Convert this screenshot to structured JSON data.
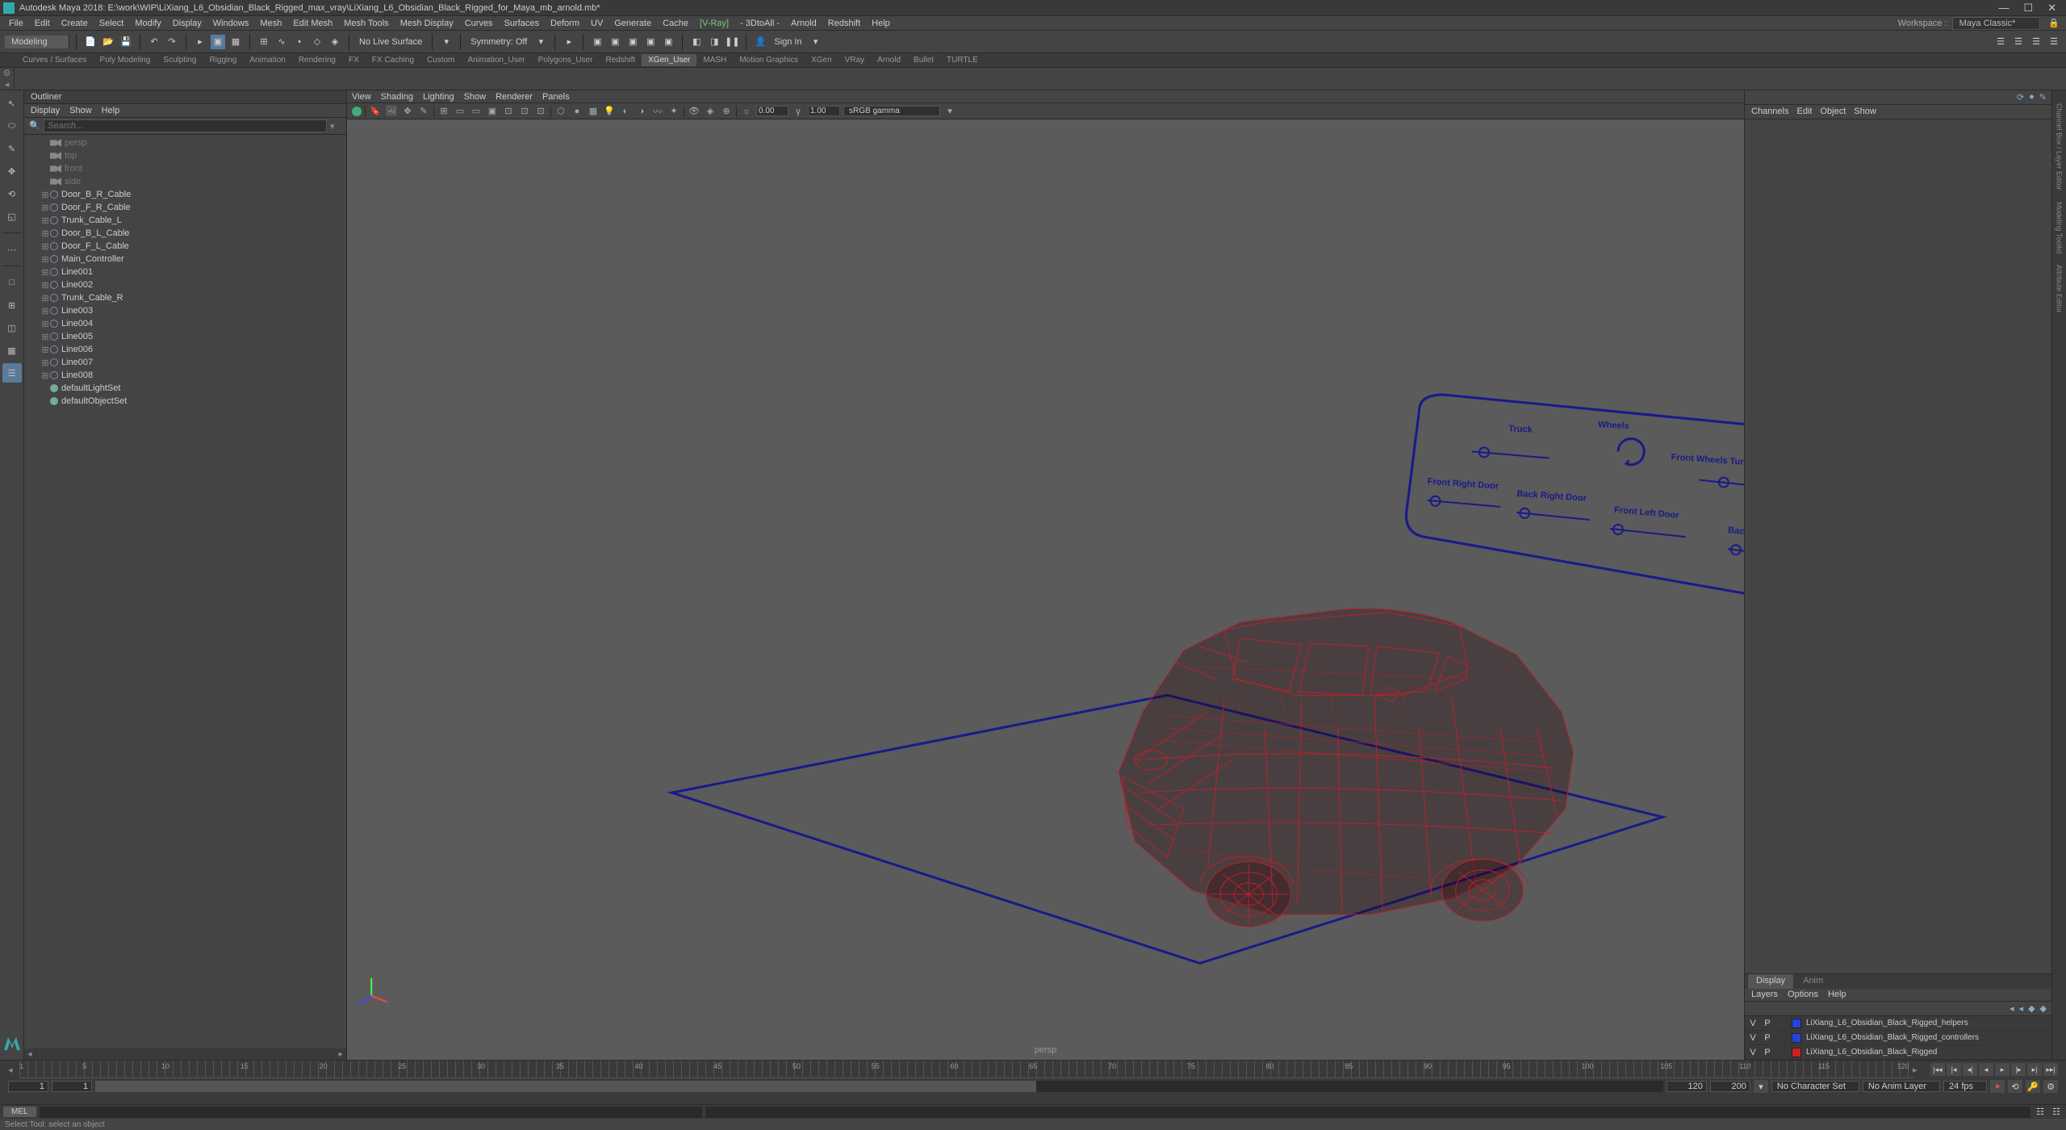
{
  "app": {
    "title": "Autodesk Maya 2018: E:\\work\\WIP\\LiXiang_L6_Obsidian_Black_Rigged_max_vray\\LiXiang_L6_Obsidian_Black_Rigged_for_Maya_mb_arnold.mb*"
  },
  "menubar": {
    "items": [
      "File",
      "Edit",
      "Create",
      "Select",
      "Modify",
      "Display",
      "Windows",
      "Mesh",
      "Edit Mesh",
      "Mesh Tools",
      "Mesh Display",
      "Curves",
      "Surfaces",
      "Deform",
      "UV",
      "Generate",
      "Cache"
    ],
    "extra": [
      "[V-Ray]",
      "- 3DtoAll -",
      "Arnold",
      "Redshift",
      "Help"
    ],
    "workspace_label": "Workspace :",
    "workspace_value": "Maya Classic*"
  },
  "statusbar": {
    "mode": "Modeling",
    "no_live": "No Live Surface",
    "symmetry": "Symmetry: Off",
    "signin": "Sign In"
  },
  "shelf_tabs": [
    "Curves / Surfaces",
    "Poly Modeling",
    "Sculpting",
    "Rigging",
    "Animation",
    "Rendering",
    "FX",
    "FX Caching",
    "Custom",
    "Animation_User",
    "Polygons_User",
    "Redshift",
    "XGen_User",
    "MASH",
    "Motion Graphics",
    "XGen",
    "VRay",
    "Arnold",
    "Bullet",
    "TURTLE"
  ],
  "shelf_active": "XGen_User",
  "outliner": {
    "title": "Outliner",
    "menu": [
      "Display",
      "Show",
      "Help"
    ],
    "search_placeholder": "Search...",
    "nodes": [
      {
        "name": "persp",
        "icon": "cam",
        "dim": true,
        "lvl": 1
      },
      {
        "name": "top",
        "icon": "cam",
        "dim": true,
        "lvl": 1
      },
      {
        "name": "front",
        "icon": "cam",
        "dim": true,
        "lvl": 1
      },
      {
        "name": "side",
        "icon": "cam",
        "dim": true,
        "lvl": 1
      },
      {
        "name": "Door_B_R_Cable",
        "icon": "curve",
        "lvl": 1,
        "exp": true
      },
      {
        "name": "Door_F_R_Cable",
        "icon": "curve",
        "lvl": 1,
        "exp": true
      },
      {
        "name": "Trunk_Cable_L",
        "icon": "curve",
        "lvl": 1,
        "exp": true
      },
      {
        "name": "Door_B_L_Cable",
        "icon": "curve",
        "lvl": 1,
        "exp": true
      },
      {
        "name": "Door_F_L_Cable",
        "icon": "curve",
        "lvl": 1,
        "exp": true
      },
      {
        "name": "Main_Controller",
        "icon": "curve",
        "lvl": 1,
        "exp": true
      },
      {
        "name": "Line001",
        "icon": "curve",
        "lvl": 1,
        "exp": true
      },
      {
        "name": "Line002",
        "icon": "curve",
        "lvl": 1,
        "exp": true
      },
      {
        "name": "Trunk_Cable_R",
        "icon": "curve",
        "lvl": 1,
        "exp": true
      },
      {
        "name": "Line003",
        "icon": "curve",
        "lvl": 1,
        "exp": true
      },
      {
        "name": "Line004",
        "icon": "curve",
        "lvl": 1,
        "exp": true
      },
      {
        "name": "Line005",
        "icon": "curve",
        "lvl": 1,
        "exp": true
      },
      {
        "name": "Line006",
        "icon": "curve",
        "lvl": 1,
        "exp": true
      },
      {
        "name": "Line007",
        "icon": "curve",
        "lvl": 1,
        "exp": true
      },
      {
        "name": "Line008",
        "icon": "curve",
        "lvl": 1,
        "exp": true
      },
      {
        "name": "defaultLightSet",
        "icon": "set",
        "lvl": 1
      },
      {
        "name": "defaultObjectSet",
        "icon": "set",
        "lvl": 1
      }
    ]
  },
  "viewport": {
    "menu": [
      "View",
      "Shading",
      "Lighting",
      "Show",
      "Renderer",
      "Panels"
    ],
    "exposure": "0.00",
    "gamma": "1.00",
    "gamma_mode": "sRGB gamma",
    "camera": "persp",
    "rig_labels": {
      "truck": "Truck",
      "wheels": "Wheels",
      "fwt": "Front Wheels Turn",
      "frd": "Front Right Door",
      "brd": "Back Right Door",
      "fld": "Front Left Door",
      "bld": "Back Left Door"
    }
  },
  "channels": {
    "tabs": [
      "Channels",
      "Edit",
      "Object",
      "Show"
    ]
  },
  "layers": {
    "tabs": {
      "display": "Display",
      "anim": "Anim"
    },
    "menu": [
      "Layers",
      "Options",
      "Help"
    ],
    "rows": [
      {
        "vis": "V",
        "p": "P",
        "color": "#2244dd",
        "name": "LiXiang_L6_Obsidian_Black_Rigged_helpers"
      },
      {
        "vis": "V",
        "p": "P",
        "color": "#2244dd",
        "name": "LiXiang_L6_Obsidian_Black_Rigged_controllers"
      },
      {
        "vis": "V",
        "p": "P",
        "color": "#cc2222",
        "name": "LiXiang_L6_Obsidian_Black_Rigged"
      }
    ]
  },
  "timeline": {
    "start": "1",
    "end": "120",
    "range_start": "1",
    "range_end": "120",
    "out": "200",
    "char_set": "No Character Set",
    "anim_layer": "No Anim Layer",
    "fps": "24 fps",
    "marks": [
      1,
      5,
      10,
      15,
      20,
      25,
      30,
      35,
      40,
      45,
      50,
      55,
      60,
      65,
      70,
      75,
      80,
      85,
      90,
      95,
      100,
      105,
      110,
      115,
      120
    ]
  },
  "command": {
    "lang": "MEL"
  },
  "helpline": "Select Tool: select an object"
}
